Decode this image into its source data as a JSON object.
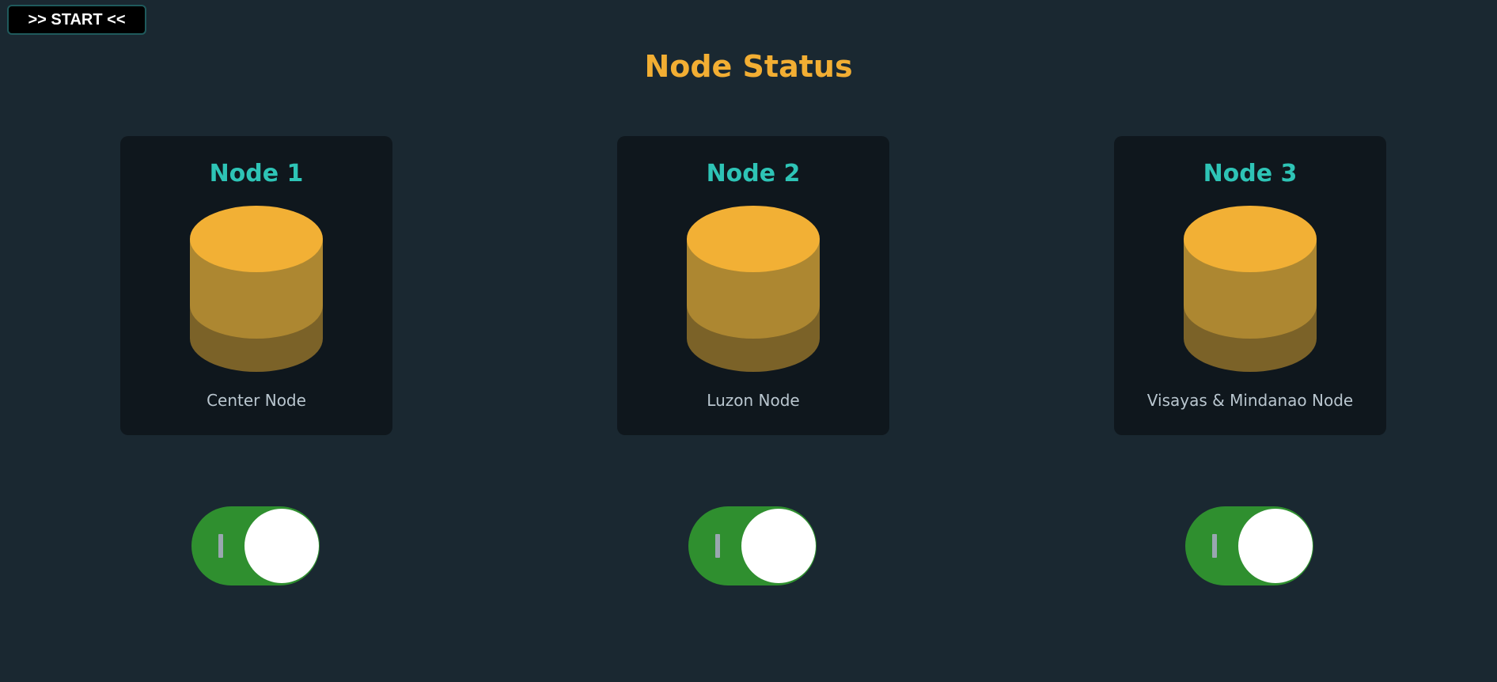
{
  "start_button": {
    "label": ">> START <<"
  },
  "page_title": "Node Status",
  "nodes": [
    {
      "title": "Node 1",
      "label": "Center Node",
      "icon": "database-icon",
      "toggle": {
        "state": "on",
        "mark": "I"
      }
    },
    {
      "title": "Node 2",
      "label": "Luzon Node",
      "icon": "database-icon",
      "toggle": {
        "state": "on",
        "mark": "I"
      }
    },
    {
      "title": "Node 3",
      "label": "Visayas & Mindanao Node",
      "icon": "database-icon",
      "toggle": {
        "state": "on",
        "mark": "I"
      }
    }
  ],
  "colors": {
    "background": "#1a2831",
    "card": "#0f171d",
    "title_accent": "#f2ae33",
    "node_title": "#2ec4b6",
    "database_top": "#f2b035",
    "toggle_on": "#2f8f2f"
  }
}
